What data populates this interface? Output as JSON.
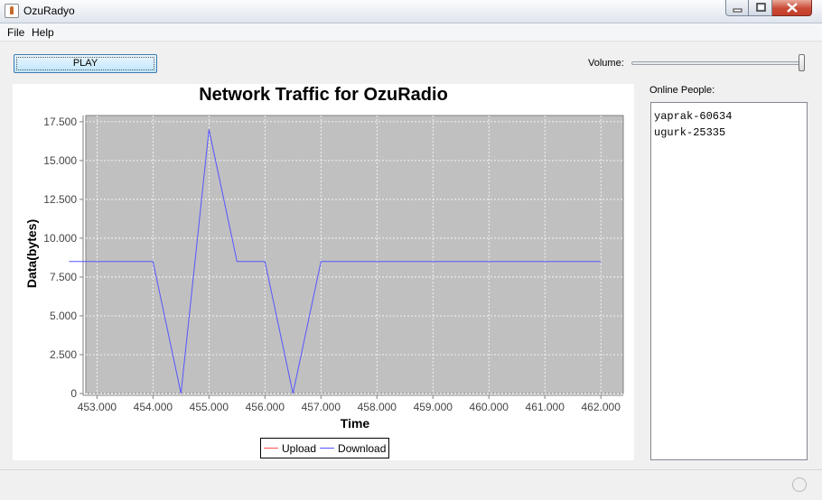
{
  "window": {
    "title": "OzuRadyo"
  },
  "menu": {
    "items": [
      "File",
      "Help"
    ]
  },
  "controls": {
    "play_label": "PLAY",
    "volume_label": "Volume:",
    "volume_level": 1.0
  },
  "people": {
    "label": "Online People:",
    "list": [
      "yaprak-60634",
      "ugurk-25335"
    ]
  },
  "colors": {
    "plot_bg": "#c0c0c0",
    "upload": "#ff5555",
    "download": "#5555ff"
  },
  "chart_data": {
    "type": "line",
    "title": "Network Traffic for OzuRadio",
    "xlabel": "Time",
    "ylabel": "Data(bytes)",
    "xlim": [
      452.8,
      462.4
    ],
    "ylim": [
      0,
      17900
    ],
    "x_ticks": [
      "453.000",
      "454.000",
      "455.000",
      "456.000",
      "457.000",
      "458.000",
      "459.000",
      "460.000",
      "461.000",
      "462.000"
    ],
    "y_ticks": [
      "0",
      "2.500",
      "5.000",
      "7.500",
      "10.000",
      "12.500",
      "15.000",
      "17.500"
    ],
    "grid": true,
    "legend_position": "bottom",
    "series": [
      {
        "name": "Upload",
        "color": "#ff5555",
        "x": [],
        "y": []
      },
      {
        "name": "Download",
        "color": "#5555ff",
        "x": [
          452.5,
          453.0,
          453.5,
          454.0,
          454.5,
          455.0,
          455.5,
          456.0,
          456.5,
          457.0,
          457.5,
          458.0,
          458.5,
          459.0,
          459.5,
          460.0,
          460.5,
          461.0,
          461.5,
          462.0
        ],
        "y": [
          8500,
          8500,
          8500,
          8500,
          0,
          17000,
          8500,
          8500,
          0,
          8500,
          8500,
          8500,
          8500,
          8500,
          8500,
          8500,
          8500,
          8500,
          8500,
          8500
        ]
      }
    ]
  }
}
